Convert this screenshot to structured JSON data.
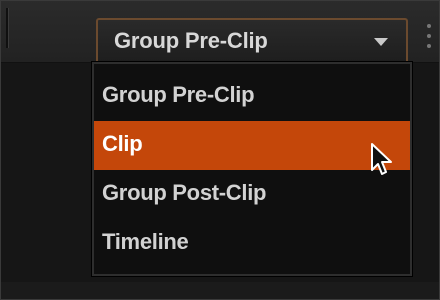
{
  "dropdown": {
    "selected_label": "Group Pre-Clip",
    "arrow_icon": "triangle-down-icon",
    "accent_border": "#6b4a2e"
  },
  "menu": {
    "items": [
      {
        "label": "Group Pre-Clip",
        "selected": false
      },
      {
        "label": "Clip",
        "selected": true
      },
      {
        "label": "Group Post-Clip",
        "selected": false
      },
      {
        "label": "Timeline",
        "selected": false
      }
    ],
    "highlight_color": "#c4470a"
  },
  "cursor": {
    "icon": "pointer-arrow-icon"
  },
  "toolbar": {
    "grip_icon": "vertical-grip-icon"
  }
}
